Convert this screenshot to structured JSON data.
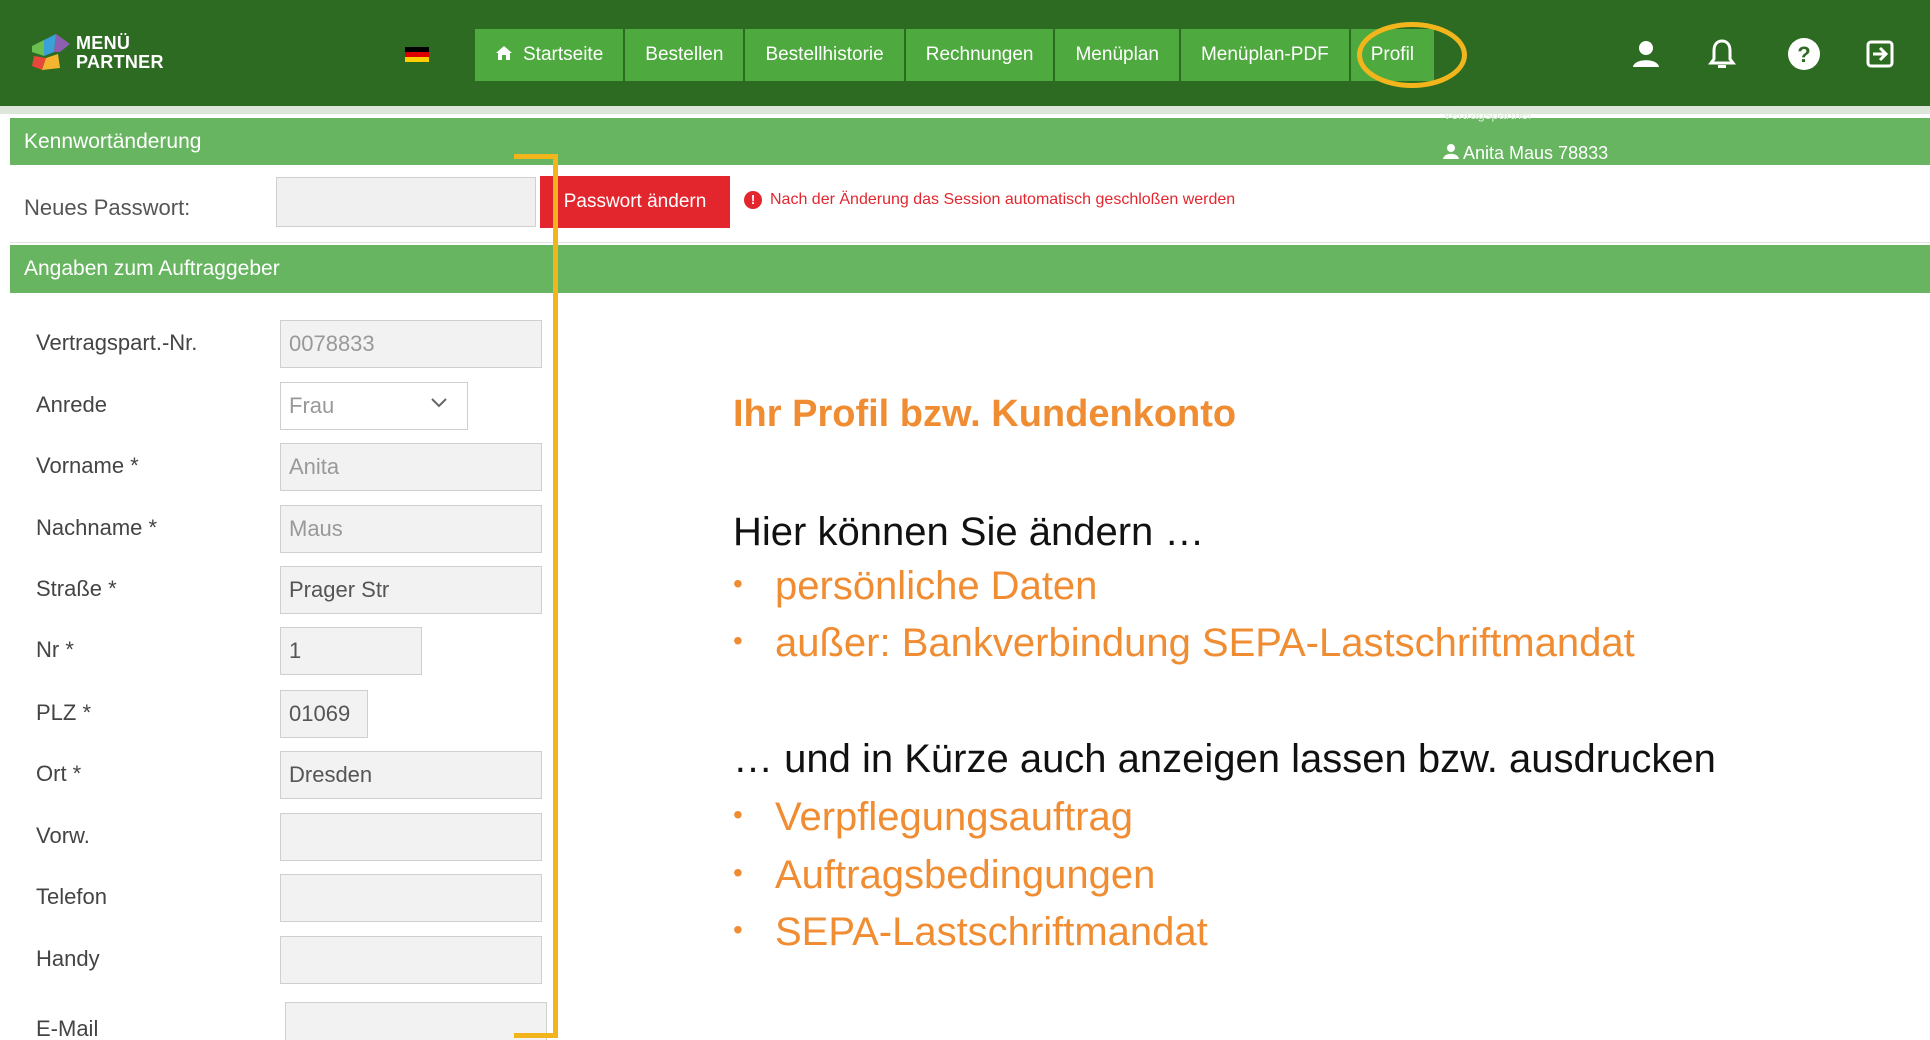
{
  "header": {
    "logo_line1": "MENÜ",
    "logo_line2": "PARTNER",
    "language_flag": "german-flag",
    "nav": [
      {
        "label": "Startseite",
        "icon": "home-icon"
      },
      {
        "label": "Bestellen"
      },
      {
        "label": "Bestellhistorie"
      },
      {
        "label": "Rechnungen"
      },
      {
        "label": "Menüplan"
      },
      {
        "label": "Menüplan-PDF"
      },
      {
        "label": "Profil",
        "active": true
      }
    ],
    "right_icons": [
      "user-icon",
      "bell-icon",
      "help-icon",
      "logout-icon"
    ]
  },
  "password_section": {
    "title": "Kennwortänderung",
    "partner_label": "Vertragspartner",
    "partner_name": "Anita Maus 78833",
    "field_label": "Neues Passwort:",
    "field_value": "",
    "button_label": "Passwort ändern",
    "note": "Nach der Änderung das Session automatisch geschloßen werden"
  },
  "client_section": {
    "title": "Angaben zum Auftraggeber",
    "fields": [
      {
        "label": "Vertragspart.-Nr.",
        "value": "0078833"
      },
      {
        "label": "Anrede",
        "value": "Frau"
      },
      {
        "label": "Vorname *",
        "value": "Anita"
      },
      {
        "label": "Nachname *",
        "value": "Maus"
      },
      {
        "label": "Straße *",
        "value": "Prager Str"
      },
      {
        "label": "Nr *",
        "value": "1"
      },
      {
        "label": "PLZ *",
        "value": "01069"
      },
      {
        "label": "Ort *",
        "value": "Dresden"
      },
      {
        "label": "Vorw.",
        "value": ""
      },
      {
        "label": "Telefon",
        "value": ""
      },
      {
        "label": "Handy",
        "value": ""
      },
      {
        "label": "E-Mail",
        "value": ""
      }
    ]
  },
  "annotation": {
    "title": "Ihr Profil bzw. Kundenkonto",
    "intro": "Hier können Sie ändern …",
    "change_items": [
      "persönliche Daten",
      "außer: Bankverbindung SEPA-Lastschriftmandat"
    ],
    "show_intro": "… und in Kürze auch anzeigen lassen bzw. ausdrucken",
    "show_items": [
      "Verpflegungsauftrag",
      "Auftragsbedingungen",
      "SEPA-Lastschriftmandat"
    ]
  },
  "colors": {
    "topbar": "#2e6b22",
    "nav_button": "#4ea93f",
    "section_bar": "#67b560",
    "danger": "#e3262e",
    "highlight": "#f2b61c",
    "annotation_accent": "#f08c32"
  }
}
